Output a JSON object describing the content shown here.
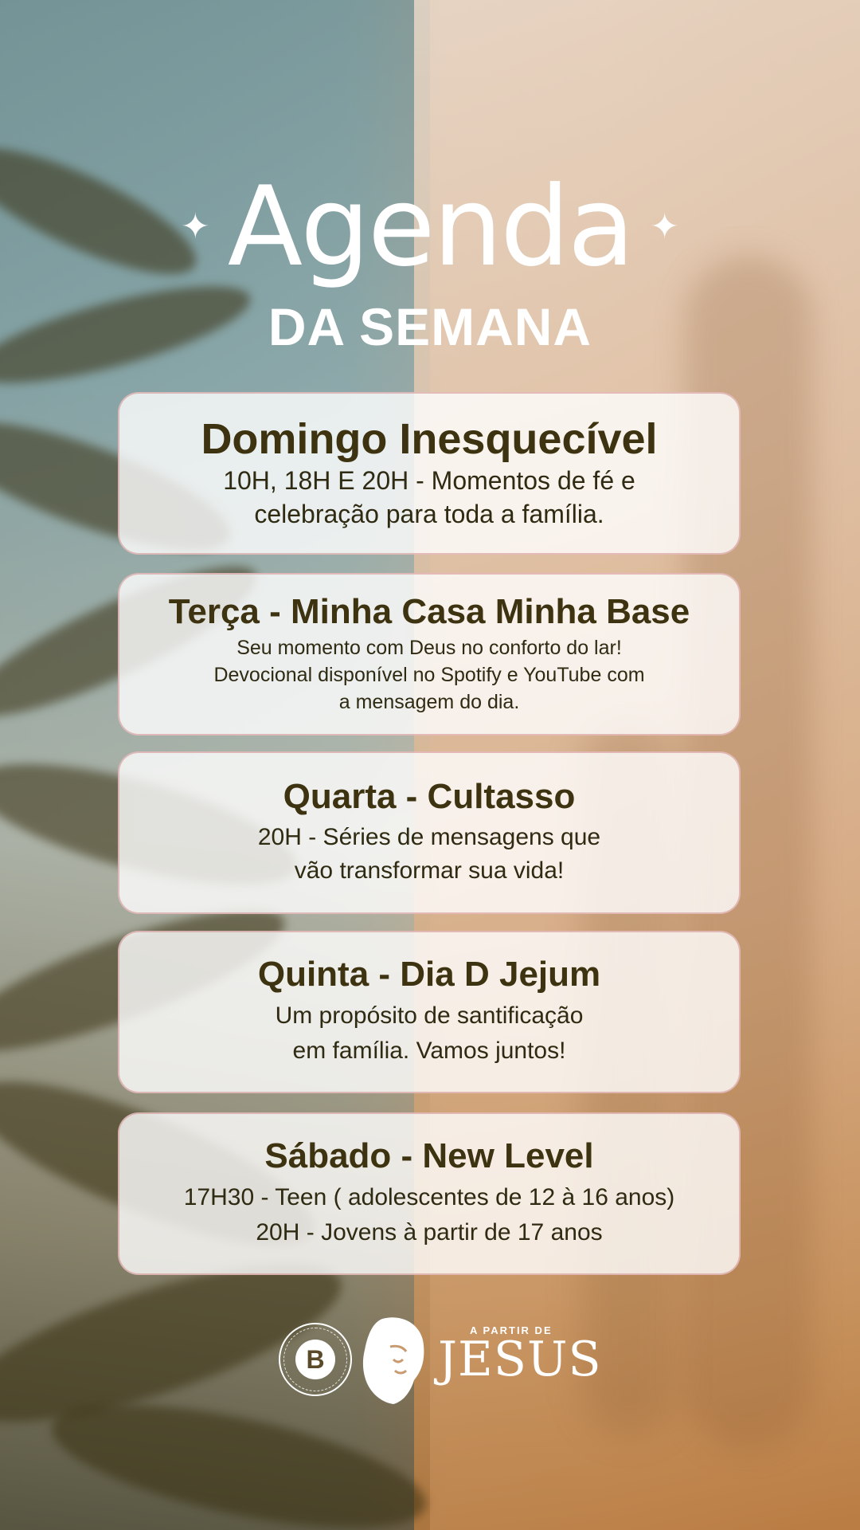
{
  "header": {
    "title": "Agenda",
    "subtitle": "DA SEMANA",
    "sparkle": "✦"
  },
  "events": [
    {
      "title": "Domingo Inesquecível",
      "lines": [
        "10H, 18H E 20H - Momentos de fé e",
        "celebração para toda a família."
      ]
    },
    {
      "title": "Terça - Minha Casa Minha Base",
      "lines": [
        "Seu momento com Deus no conforto do lar!",
        "Devocional disponível no Spotify e YouTube com",
        "a mensagem do dia."
      ]
    },
    {
      "title": "Quarta - Cultasso",
      "lines": [
        "20H - Séries de mensagens que",
        "vão transformar sua vida!"
      ]
    },
    {
      "title": "Quinta - Dia D Jejum",
      "lines": [
        "Um propósito de santificação",
        "em família. Vamos juntos!"
      ]
    },
    {
      "title": "Sábado - New Level",
      "lines": [
        "17H30 - Teen ( adolescentes de 12 à 16 anos)",
        "20H - Jovens à partir de 17 anos"
      ]
    }
  ],
  "footer": {
    "badge_letter": "B",
    "badge_ring_text": "BASE CHURCH",
    "campaign_small": "A PARTIR DE",
    "campaign_big": "JESUS"
  },
  "colors": {
    "card_bg": "#ffffffcc",
    "card_text": "#3e3310",
    "header_text": "#ffffff"
  }
}
